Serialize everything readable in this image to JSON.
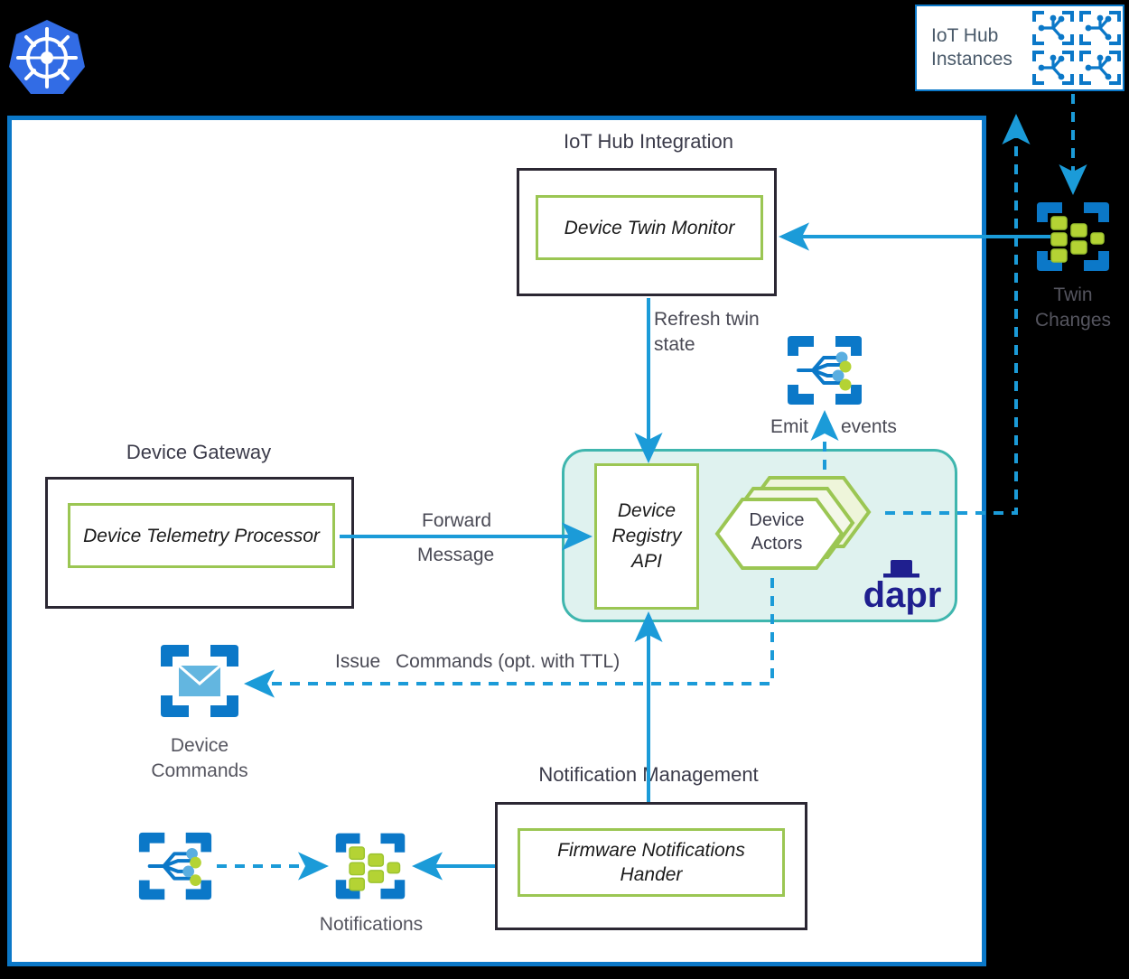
{
  "platform": {
    "logo_icon": "kubernetes-logo-icon",
    "container_border_color": "#0b78c8"
  },
  "iot_hub_instances": {
    "label": "IoT Hub\nInstances",
    "label_line1": "IoT Hub",
    "label_line2": "Instances",
    "icon": "iot-hub-icon",
    "icon_count": 4,
    "border_color": "#0b78c8"
  },
  "sections": {
    "iot_hub_integration": {
      "title": "IoT Hub Integration",
      "component": "Device Twin Monitor"
    },
    "device_gateway": {
      "title": "Device Gateway",
      "component": "Device Telemetry Processor"
    },
    "notification_management": {
      "title": "Notification Management",
      "component_line1": "Firmware Notifications",
      "component_line2": "Hander"
    }
  },
  "dapr_runtime": {
    "logo_text": "dapr",
    "logo_color": "#1f1f8f",
    "background_color": "#dff2ef",
    "border_color": "#3fb6ae",
    "registry_api_line1": "Device",
    "registry_api_line2": "Registry",
    "registry_api_line3": "API",
    "actors_line1": "Device",
    "actors_line2": "Actors",
    "actors_hex_color": "#9bc653"
  },
  "azure_icons": {
    "twin_changes": {
      "caption_line1": "Twin",
      "caption_line2": "Changes",
      "icon": "event-grid-topic-icon"
    },
    "event_grid_emit": {
      "icon": "event-grid-icon"
    },
    "device_commands": {
      "caption_line1": "Device",
      "caption_line2": "Commands",
      "icon": "service-bus-queue-icon"
    },
    "notifications": {
      "caption": "Notifications",
      "icon": "event-grid-topic-icon"
    },
    "notifications_source": {
      "icon": "event-grid-icon"
    }
  },
  "connectors": {
    "refresh_twin_state_line1": "Refresh twin",
    "refresh_twin_state_line2": "state",
    "forward_message_line1": "Forward",
    "forward_message_line2": "Message",
    "emit_events_left": "Emit",
    "emit_events_right": "events",
    "issue_commands_left": "Issue",
    "issue_commands_right": "Commands (opt. with TTL)",
    "solid_color": "#1b9bd8",
    "dashed_color": "#1b9bd8"
  }
}
